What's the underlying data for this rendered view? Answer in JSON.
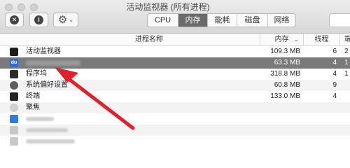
{
  "window": {
    "title": "活动监视器 (所有进程)"
  },
  "toolbar": {
    "stop_icon": "x-circle-icon",
    "info_icon": "info-circle-icon",
    "gear_icon": "gear-icon",
    "caret_glyph": "⌄",
    "stop_glyph": "✕",
    "info_glyph": "i",
    "gear_glyph": "⚙"
  },
  "tabs": [
    {
      "label": "CPU",
      "active": false
    },
    {
      "label": "内存",
      "active": true
    },
    {
      "label": "能耗",
      "active": false
    },
    {
      "label": "磁盘",
      "active": false
    },
    {
      "label": "网络",
      "active": false
    }
  ],
  "table": {
    "headers": {
      "name": "进程名称",
      "memory": "内存",
      "threads": "线程",
      "ports": "端"
    },
    "sort_glyph": "⌄",
    "rows": [
      {
        "name": "活动监视器",
        "memory": "109.3 MB",
        "threads": "6",
        "ports": "2",
        "icon": "activity-monitor-icon"
      },
      {
        "name": "",
        "memory": "63.3 MB",
        "threads": "4",
        "ports": "1",
        "icon": "baidu-icon",
        "icon_text": "du",
        "selected": true
      },
      {
        "name": "程序坞",
        "memory": "318.8 MB",
        "threads": "4",
        "ports": "1",
        "icon": "dock-icon"
      },
      {
        "name": "系统偏好设置",
        "memory": "60.8 MB",
        "threads": "9",
        "ports": "",
        "icon": "system-preferences-icon"
      },
      {
        "name": "终端",
        "memory": "133.0 MB",
        "threads": "4",
        "ports": "",
        "icon": "terminal-icon"
      },
      {
        "name": "聚焦",
        "memory": "",
        "threads": "",
        "ports": "",
        "icon": "spotlight-icon"
      },
      {
        "name": "",
        "memory": "",
        "threads": "",
        "ports": "",
        "icon": "app-icon"
      },
      {
        "name": "",
        "memory": "",
        "threads": "",
        "ports": "",
        "icon": "app-icon"
      },
      {
        "name": "",
        "memory": "",
        "threads": "",
        "ports": "",
        "icon": "app-icon"
      }
    ]
  },
  "annotation": {
    "arrow_color": "#e0202a"
  }
}
